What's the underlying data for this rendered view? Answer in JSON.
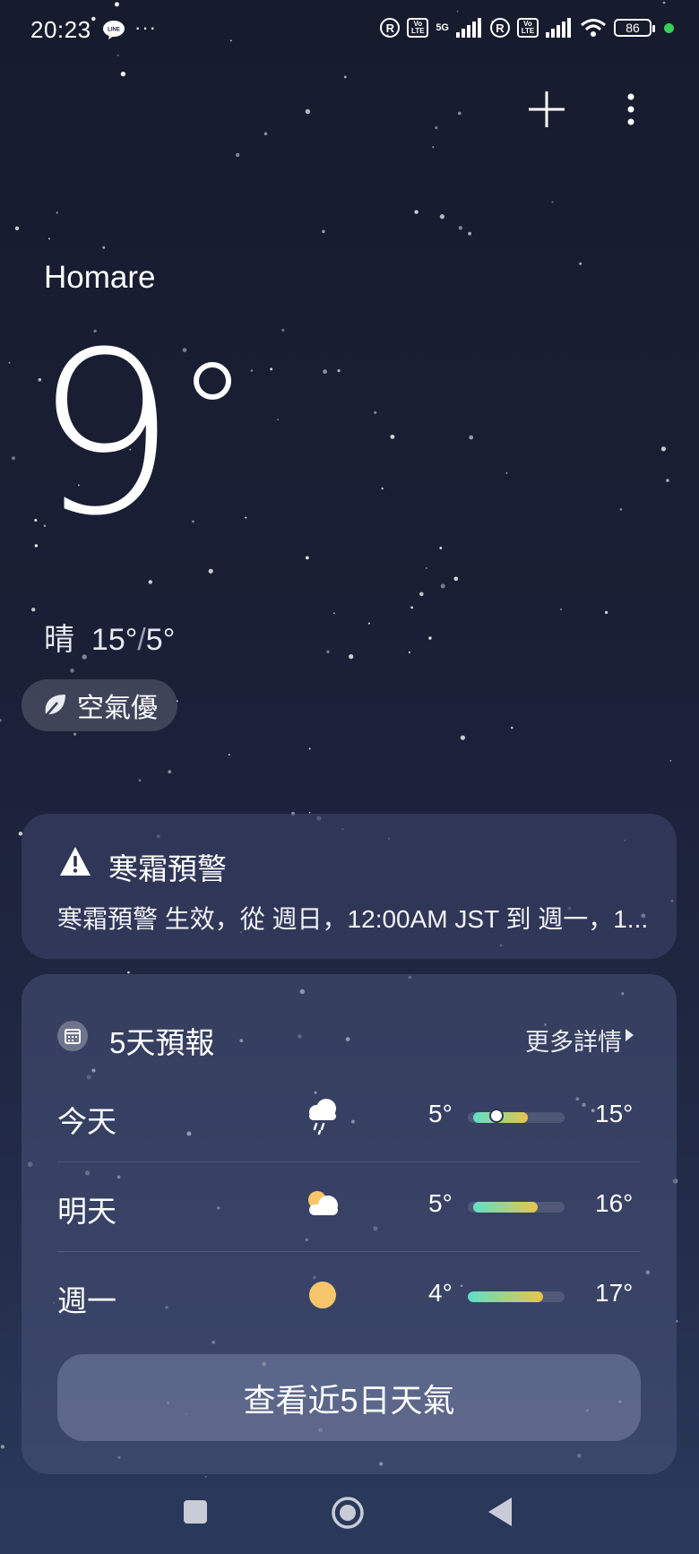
{
  "status_bar": {
    "time": "20:23",
    "app_icon": "line-app-icon",
    "more": "···",
    "volte": "Vo LTE",
    "net": "5G",
    "roaming": "R",
    "battery": "86"
  },
  "location": "Homare",
  "current": {
    "temp": "9",
    "condition": "晴",
    "high": "15°",
    "low": "5°",
    "air_quality": "空氣優"
  },
  "alert": {
    "title": "寒霜預警",
    "text": "寒霜預警 生效，從 週日，12:00AM JST 到 週一，1..."
  },
  "forecast": {
    "title": "5天預報",
    "more": "更多詳情",
    "days": [
      {
        "day": "今天",
        "icon": "rain-cloud-icon",
        "low": "5°",
        "high": "15°",
        "range_start": 0.06,
        "range_end": 0.62,
        "current_marker": 0.3
      },
      {
        "day": "明天",
        "icon": "partly-cloudy-icon",
        "low": "5°",
        "high": "16°",
        "range_start": 0.06,
        "range_end": 0.72
      },
      {
        "day": "週一",
        "icon": "sun-icon",
        "low": "4°",
        "high": "17°",
        "range_start": 0.0,
        "range_end": 0.78
      }
    ],
    "button": "查看近5日天氣"
  },
  "colors": {
    "accent_green": "#34d058",
    "range_start": "#5fe0c7",
    "range_end": "#e8c44a",
    "sun": "#f7c66b"
  }
}
